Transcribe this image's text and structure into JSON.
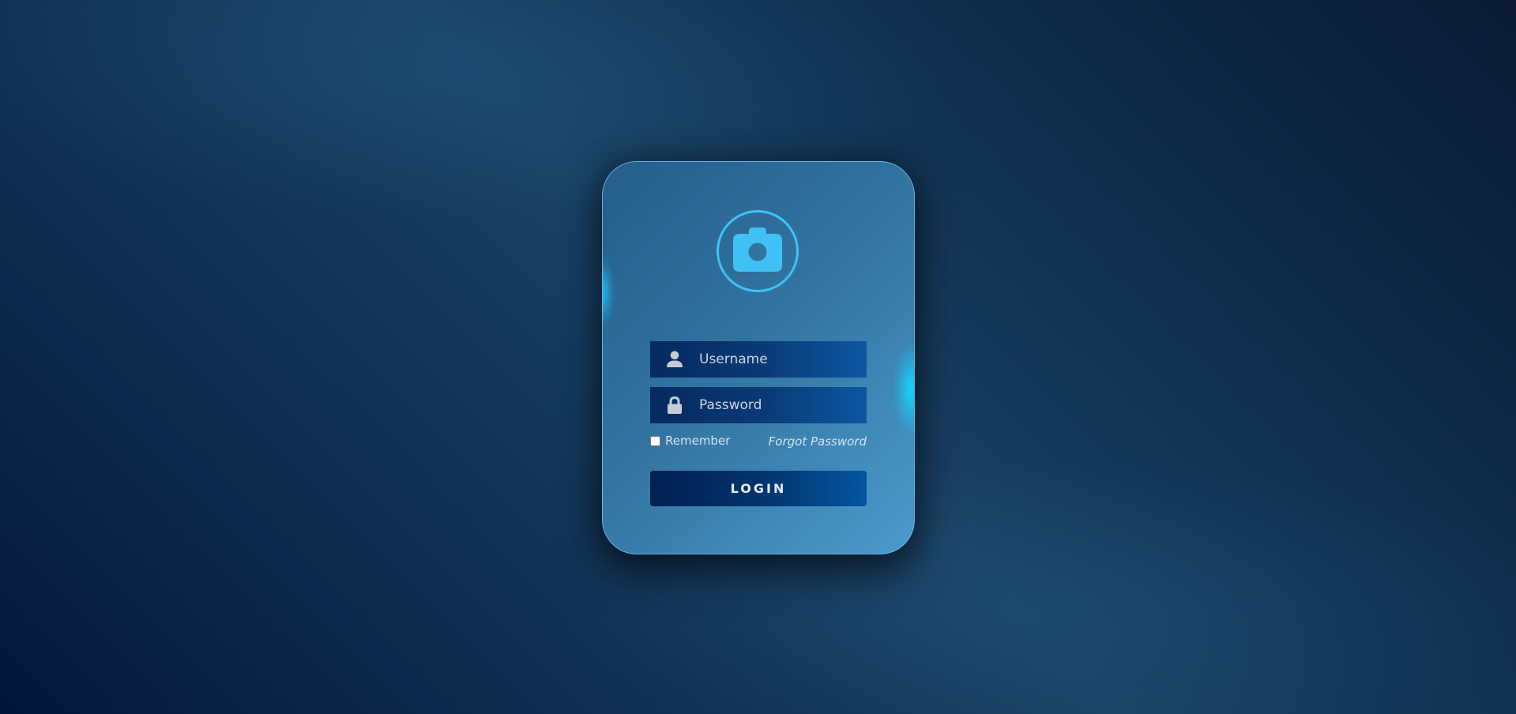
{
  "login": {
    "avatar_icon": "camera-icon",
    "username": {
      "icon": "user-icon",
      "placeholder": "Username",
      "value": ""
    },
    "password": {
      "icon": "lock-icon",
      "placeholder": "Password",
      "value": ""
    },
    "remember_label": "Remember",
    "remember_checked": false,
    "forgot_label": "Forgot Password",
    "submit_label": "LOGIN"
  },
  "colors": {
    "accent": "#3fc1f5",
    "card_gradient_start": "#245d8a",
    "card_gradient_end": "#4a9bcc",
    "field_bg": "#052a60",
    "button_bg": "#011f52",
    "background_dark": "#04163a",
    "glow": "#14d7ff"
  }
}
